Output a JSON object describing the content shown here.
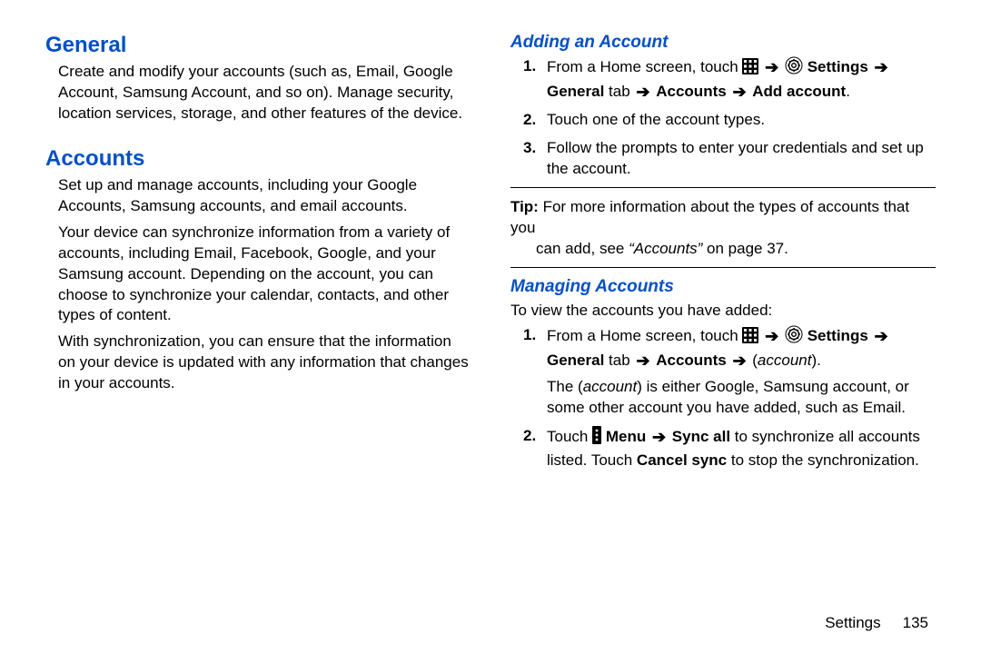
{
  "left": {
    "h_general": "General",
    "p_general": "Create and modify your accounts (such as, Email, Google Account, Samsung Account, and so on). Manage security, location services, storage, and other features of the device.",
    "h_accounts": "Accounts",
    "p_acc1": "Set up and manage accounts, including your Google Accounts, Samsung accounts, and email accounts.",
    "p_acc2": "Your device can synchronize information from a variety of accounts, including Email, Facebook, Google, and your Samsung account. Depending on the account, you can choose to synchronize your calendar, contacts, and other types of content.",
    "p_acc3": "With synchronization, you can ensure that the information on your device is updated with any information that changes in your accounts."
  },
  "right": {
    "h_adding": "Adding an Account",
    "add_step1_a": "From a Home screen, touch ",
    "add_step1_b": "Settings",
    "add_step1_c": "General",
    "add_step1_d": " tab ",
    "add_step1_e": "Accounts",
    "add_step1_f": "Add account",
    "add_step2": "Touch one of the account types.",
    "add_step3": "Follow the prompts to enter your credentials and set up the account.",
    "tip_label": "Tip:",
    "tip_line1": " For more information about the types of accounts that you",
    "tip_line2": "can add, see ",
    "tip_ref": "“Accounts”",
    "tip_after": " on page 37.",
    "h_managing": "Managing Accounts",
    "man_intro": "To view the accounts you have added:",
    "man_step1_a": "From a Home screen, touch ",
    "man_step1_b": "Settings",
    "man_step1_c": "General",
    "man_step1_d": " tab ",
    "man_step1_e": "Accounts",
    "man_step1_f": "account",
    "man_step1_after": "The (account) is either Google, Samsung account, or some other account you have added, such as Email.",
    "man_step2_a": "Touch ",
    "man_step2_b": "Menu",
    "man_step2_c": "Sync all",
    "man_step2_d": " to synchronize all accounts listed. Touch ",
    "man_step2_e": "Cancel sync",
    "man_step2_f": " to stop the synchronization."
  },
  "footer": {
    "section": "Settings",
    "page": "135"
  }
}
